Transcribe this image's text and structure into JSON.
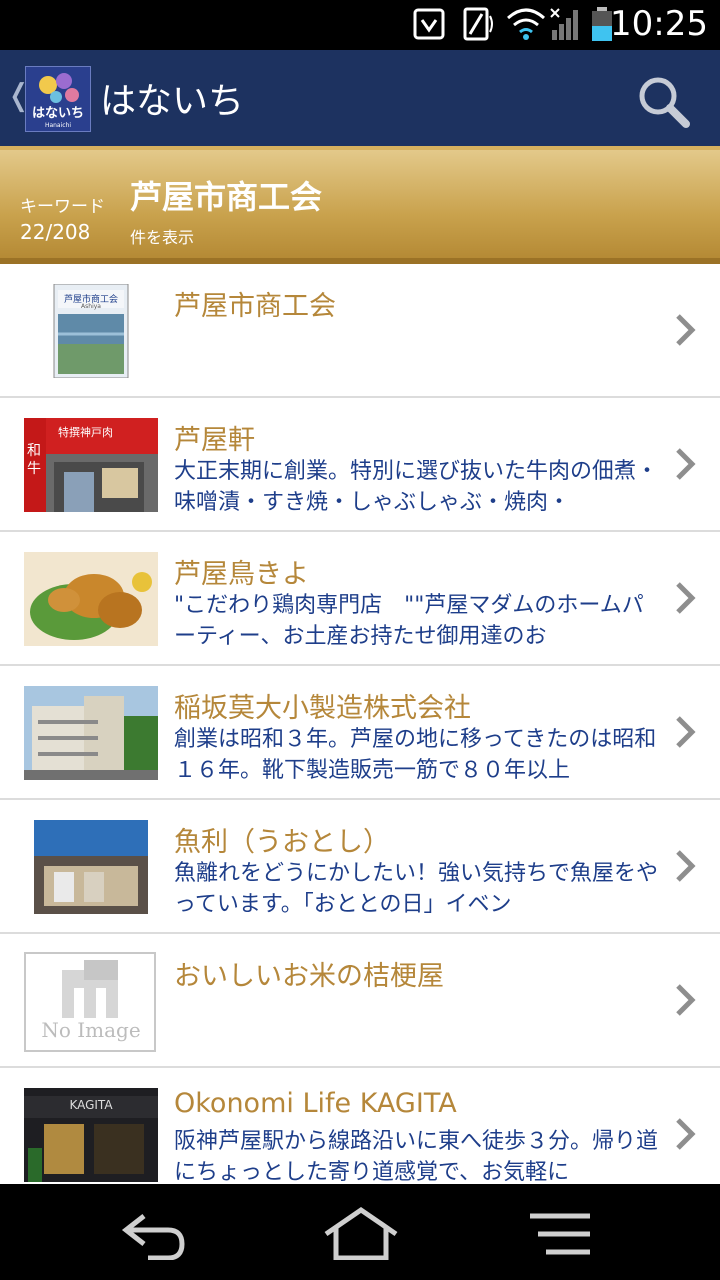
{
  "status_bar": {
    "time": "10:25"
  },
  "app_bar": {
    "title": "はないち",
    "logo_text": "はないち",
    "logo_sub": "Hanaichi"
  },
  "keyword_bar": {
    "label": "キーワード",
    "count": "22/208",
    "keyword": "芦屋市商工会",
    "subtitle": "件を表示"
  },
  "items": [
    {
      "name": "芦屋市商工会",
      "desc": "",
      "thumb": "pamphlet"
    },
    {
      "name": "芦屋軒",
      "desc": "大正末期に創業。特別に選び抜いた牛肉の佃煮・味噌漬・すき焼・しゃぶしゃぶ・焼肉・",
      "thumb": "shop-red"
    },
    {
      "name": "芦屋鳥きよ",
      "desc": "\"こだわり鶏肉専門店　\"\"芦屋マダムのホームパーティー、お土産お持たせ御用達のお",
      "thumb": "fried-chicken"
    },
    {
      "name": "稲坂莫大小製造株式会社",
      "desc": "創業は昭和３年。芦屋の地に移ってきたのは昭和１６年。靴下製造販売一筋で８０年以上",
      "thumb": "building"
    },
    {
      "name": "魚利（うおとし）",
      "desc": "魚離れをどうにかしたい！強い気持ちで魚屋をやっています。「おととの日」イベン",
      "thumb": "shop-blue"
    },
    {
      "name": "おいしいお米の桔梗屋",
      "desc": "",
      "thumb": "no-image"
    },
    {
      "name": "Okonomi Life KAGITA",
      "desc": "阪神芦屋駅から線路沿いに東へ徒歩３分。帰り道にちょっとした寄り道感覚で、お気軽に",
      "thumb": "shop-dark"
    }
  ],
  "thumb_labels": {
    "pamphlet_title": "芦屋市商工会",
    "pamphlet_sub": "Ashiya",
    "shop_red_sign": "特撰神戸肉",
    "shop_red_side": "和牛",
    "no_image": "No Image",
    "kagita_sign": "KAGITA"
  },
  "colors": {
    "app_bar": "#1d3260",
    "keyword_bar": "#c9a24d",
    "item_name": "#b5873a",
    "item_desc": "#1e3e8a"
  },
  "icons": [
    "back-chevron-icon",
    "search-icon",
    "chevron-right-icon",
    "back-icon",
    "home-icon",
    "menu-icon",
    "wifi-icon",
    "signal-icon",
    "battery-icon"
  ]
}
